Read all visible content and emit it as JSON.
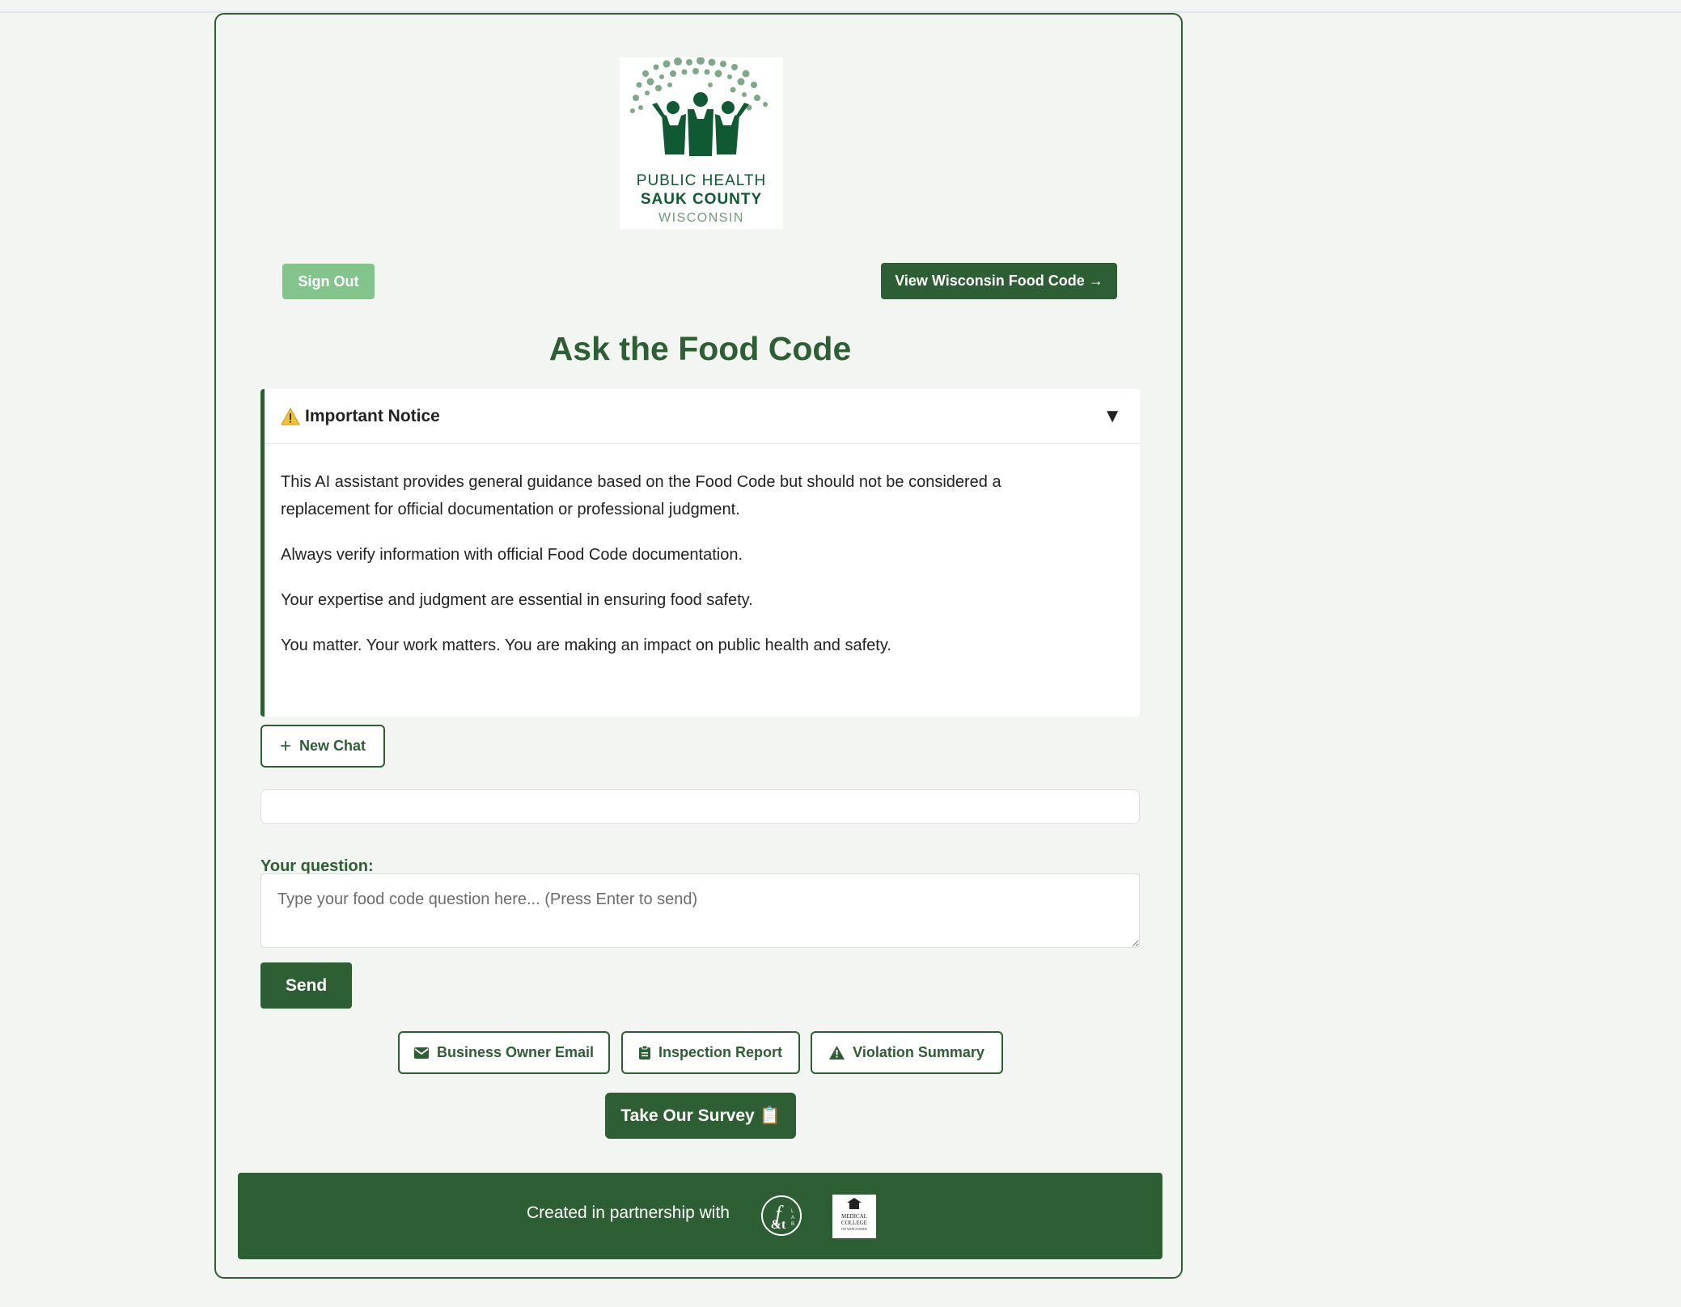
{
  "logo": {
    "line1": "PUBLIC HEALTH",
    "line2": "SAUK COUNTY",
    "line3": "WISCONSIN"
  },
  "header": {
    "sign_out": "Sign Out",
    "view_code": "View Wisconsin Food Code →"
  },
  "page_title": "Ask the Food Code",
  "notice": {
    "title": "Important Notice",
    "toggle": "▼",
    "paragraphs": [
      "This AI assistant provides general guidance based on the Food Code but should not be considered a replacement for official documentation or professional judgment.",
      "Always verify information with official Food Code documentation.",
      "Your expertise and judgment are essential in ensuring food safety.",
      "You matter. Your work matters. You are making an impact on public health and safety."
    ]
  },
  "chat": {
    "new_chat": "New Chat",
    "question_label": "Your question:",
    "question_placeholder": "Type your food code question here... (Press Enter to send)",
    "question_value": "",
    "send": "Send"
  },
  "templates": {
    "business_email": "Business Owner Email",
    "inspection_report": "Inspection Report",
    "violation_summary": "Violation Summary"
  },
  "survey": "Take Our Survey 📋",
  "footer": {
    "text": "Created in partnership with",
    "logo2_text": "MEDICAL COLLEGE OF WISCONSIN"
  },
  "colors": {
    "primary": "#2e5e34",
    "signout": "#82c48c",
    "background": "#f3f5f2"
  }
}
